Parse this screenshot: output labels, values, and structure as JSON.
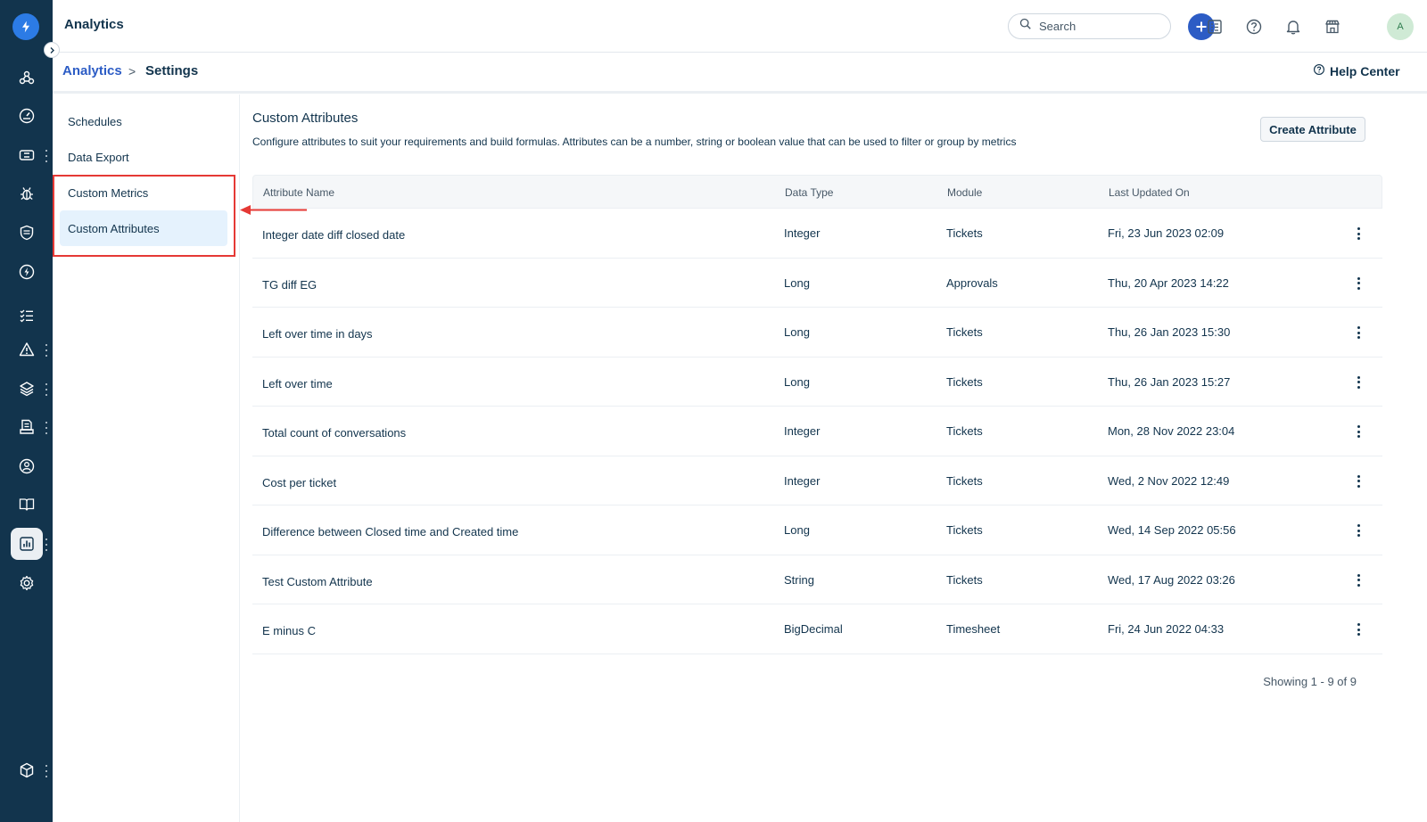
{
  "header": {
    "title": "Analytics",
    "search_placeholder": "Search",
    "avatar_initial": "A"
  },
  "breadcrumb": {
    "parent": "Analytics",
    "separator": ">",
    "current": "Settings",
    "help_center": "Help Center"
  },
  "settings_menu": {
    "items": [
      {
        "label": "Schedules"
      },
      {
        "label": "Data Export"
      },
      {
        "label": "Custom Metrics"
      },
      {
        "label": "Custom Attributes",
        "selected": true
      }
    ]
  },
  "main": {
    "title": "Custom Attributes",
    "description": "Configure attributes to suit your requirements and build formulas. Attributes can be a number, string or boolean value that can be used to filter or group by metrics",
    "create_button": "Create Attribute"
  },
  "table": {
    "columns": [
      "Attribute Name",
      "Data Type",
      "Module",
      "Last Updated On"
    ],
    "rows": [
      {
        "name": "Integer date diff closed date",
        "type": "Integer",
        "module": "Tickets",
        "updated": "Fri, 23 Jun 2023 02:09"
      },
      {
        "name": "TG diff EG",
        "type": "Long",
        "module": "Approvals",
        "updated": "Thu, 20 Apr 2023 14:22"
      },
      {
        "name": "Left over time in days",
        "type": "Long",
        "module": "Tickets",
        "updated": "Thu, 26 Jan 2023 15:30"
      },
      {
        "name": "Left over time",
        "type": "Long",
        "module": "Tickets",
        "updated": "Thu, 26 Jan 2023 15:27"
      },
      {
        "name": "Total count of conversations",
        "type": "Integer",
        "module": "Tickets",
        "updated": "Mon, 28 Nov 2022 23:04"
      },
      {
        "name": "Cost per ticket",
        "type": "Integer",
        "module": "Tickets",
        "updated": "Wed, 2 Nov 2022 12:49"
      },
      {
        "name": "Difference between Closed time and Created time",
        "type": "Long",
        "module": "Tickets",
        "updated": "Wed, 14 Sep 2022 05:56"
      },
      {
        "name": "Test Custom Attribute",
        "type": "String",
        "module": "Tickets",
        "updated": "Wed, 17 Aug 2022 03:26"
      },
      {
        "name": "E minus C",
        "type": "BigDecimal",
        "module": "Timesheet",
        "updated": "Fri, 24 Jun 2022 04:33"
      }
    ]
  },
  "pagination": {
    "text": "Showing 1 - 9 of 9"
  },
  "colors": {
    "rail": "#12344d",
    "accent": "#2c5cc5",
    "highlight": "#e53935",
    "selected_bg": "#e5f2fd"
  },
  "icons": {
    "rail": [
      "logo-bolt-icon",
      "hub-icon",
      "dashboard-gauge-icon",
      "ticket-icon",
      "bug-icon",
      "shield-icon",
      "bolt-circle-icon",
      "checklist-icon",
      "alert-triangle-icon",
      "layers-icon",
      "document-icon",
      "users-circle-icon",
      "book-icon",
      "analytics-chart-icon",
      "gear-icon",
      "cube-icon"
    ],
    "top": [
      "search-icon",
      "plus-icon",
      "forms-icon",
      "help-icon",
      "bell-icon",
      "marketplace-icon"
    ]
  }
}
